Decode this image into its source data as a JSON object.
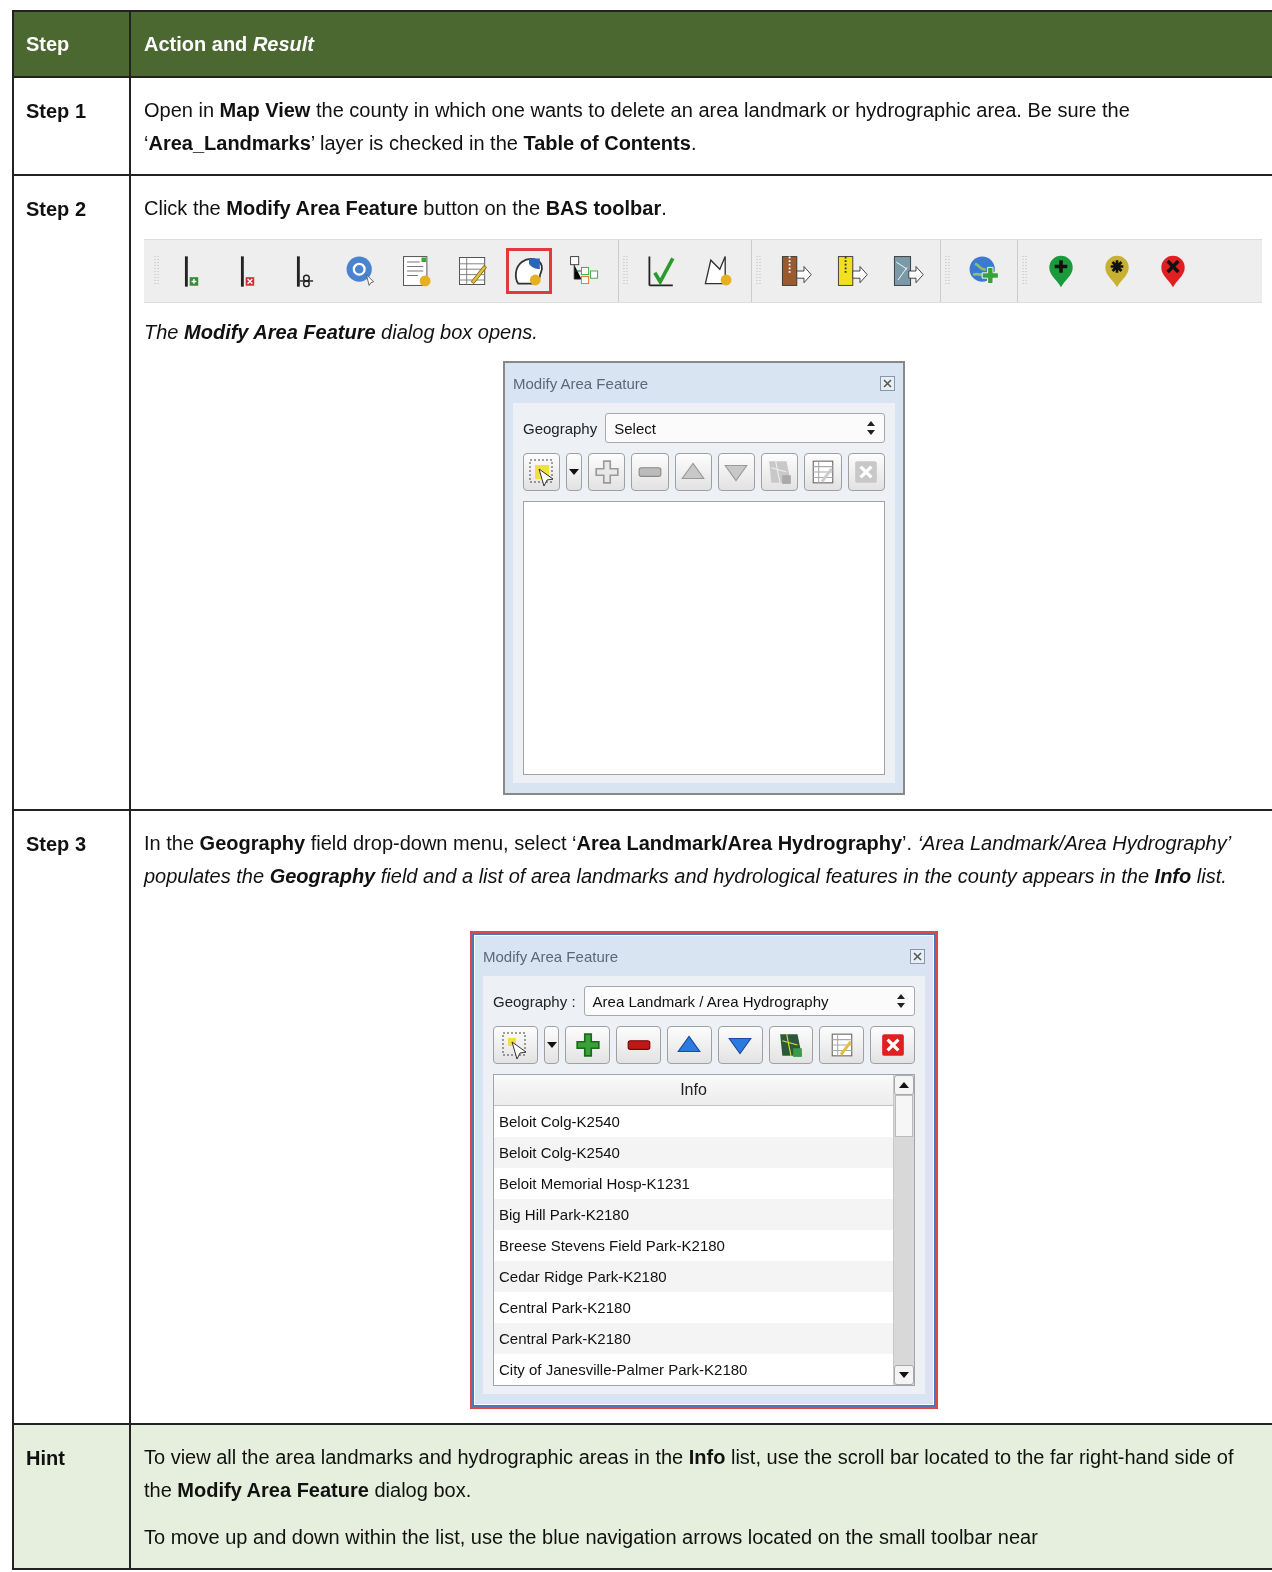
{
  "table": {
    "header": {
      "step": "Step",
      "action": "Action and *Result*"
    },
    "rows": [
      {
        "step": "Step 1",
        "shaded": false,
        "blocks": [
          {
            "kind": "paragraph",
            "text": "Open in **Map View** the county in which one wants to delete an area landmark or hydrographic area. Be sure the ‘**Area_Landmarks**’ layer is checked in the **Table of Contents**."
          }
        ]
      },
      {
        "step": "Step 2",
        "shaded": false,
        "blocks": [
          {
            "kind": "paragraph",
            "text": "Click the **Modify Area Feature** button on the **BAS toolbar**."
          },
          {
            "kind": "toolbar",
            "groups": [
              {
                "buttons": [
                  {
                    "highlighted": false
                  },
                  {
                    "highlighted": false
                  },
                  {
                    "highlighted": false
                  },
                  {
                    "highlighted": false
                  },
                  {
                    "highlighted": false
                  },
                  {
                    "highlighted": false
                  },
                  {
                    "highlighted": true
                  },
                  {
                    "highlighted": false
                  }
                ]
              },
              {
                "buttons": [
                  {
                    "highlighted": false
                  },
                  {
                    "highlighted": false
                  }
                ]
              },
              {
                "buttons": [
                  {
                    "highlighted": false
                  },
                  {
                    "highlighted": false
                  },
                  {
                    "highlighted": false
                  }
                ]
              },
              {
                "buttons": [
                  {
                    "highlighted": false
                  }
                ]
              },
              {
                "buttons": [
                  {
                    "highlighted": false
                  },
                  {
                    "highlighted": false
                  },
                  {
                    "highlighted": false
                  }
                ]
              }
            ]
          },
          {
            "kind": "caption",
            "text": "The **Modify Area Feature** dialog box opens."
          },
          {
            "kind": "dialog",
            "title": "Modify Area Feature",
            "highlighted": false,
            "geography_label": "Geography",
            "geography_value": "Select",
            "tools_disabled": true
          }
        ]
      },
      {
        "step": "Step 3",
        "shaded": false,
        "blocks": [
          {
            "kind": "paragraph",
            "text": "In the **Geography** field drop-down menu, select ‘**Area Landmark/Area Hydrography**’.",
            "result": "‘Area Landmark/Area Hydrography’ populates the **Geography** field and a list of area landmarks and hydrological features in the county appears in the **Info** list."
          },
          {
            "kind": "dialog",
            "title": "Modify Area Feature",
            "highlighted": true,
            "geography_label": "Geography :",
            "geography_value": "Area Landmark / Area Hydrography",
            "tools_disabled": false,
            "list_header": "Info",
            "list_items": [
              "Beloit Colg-K2540",
              "Beloit Colg-K2540",
              "Beloit Memorial Hosp-K1231",
              "Big Hill Park-K2180",
              "Breese Stevens Field Park-K2180",
              "Cedar Ridge Park-K2180",
              "Central Park-K2180",
              "Central Park-K2180",
              "City of Janesville-Palmer Park-K2180"
            ]
          }
        ]
      },
      {
        "step": "Hint",
        "shaded": true,
        "blocks": [
          {
            "kind": "paragraph",
            "text": "To view all the area landmarks and hydrographic areas in the **Info** list, use the scroll bar located to the far right-hand side of the **Modify Area Feature** dialog box."
          },
          {
            "kind": "paragraph",
            "text": "To move up and down within the list, use the blue navigation arrows located on the small toolbar near"
          }
        ]
      }
    ]
  }
}
